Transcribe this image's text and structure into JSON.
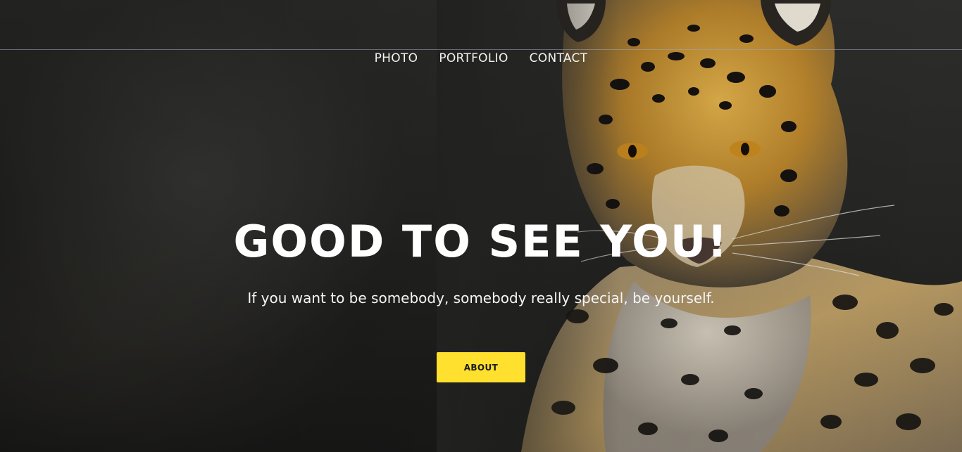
{
  "nav": {
    "items": [
      {
        "label": "PHOTO"
      },
      {
        "label": "PORTFOLIO"
      },
      {
        "label": "CONTACT"
      }
    ]
  },
  "hero": {
    "headline": "GOOD TO SEE YOU!",
    "tagline": "If you want to be somebody, somebody really special, be yourself.",
    "button_label": "ABOUT",
    "background_subject": "jaguar-photo"
  },
  "colors": {
    "accent": "#ffe02f",
    "background": "#262624",
    "text": "#ffffff",
    "jaguar_fur": "#d9a23a",
    "jaguar_spots": "#141210"
  }
}
